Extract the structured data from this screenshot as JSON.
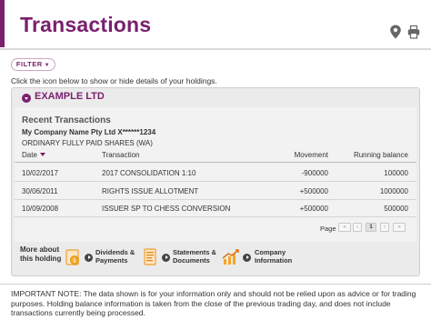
{
  "header": {
    "title": "Transactions",
    "icons": [
      "location-pin-icon",
      "printer-icon"
    ],
    "accent_color": "#7a1f6e"
  },
  "filter": {
    "label": "FILTER"
  },
  "hint": "Click the icon below to show or hide details of your holdings.",
  "holding": {
    "name": "EXAMPLE LTD",
    "section_title": "Recent Transactions",
    "company": "My Company Name Pty Ltd X******1234",
    "security": "ORDINARY FULLY PAID SHARES (WA)",
    "columns": [
      "Date",
      "Transaction",
      "Movement",
      "Running balance"
    ],
    "rows": [
      {
        "date": "10/02/2017",
        "transaction": "2017 CONSOLIDATION 1:10",
        "movement": "-900000",
        "balance": "100000"
      },
      {
        "date": "30/06/2011",
        "transaction": "RIGHTS ISSUE ALLOTMENT",
        "movement": "+500000",
        "balance": "1000000"
      },
      {
        "date": "10/09/2008",
        "transaction": "ISSUER SP TO CHESS CONVERSION",
        "movement": "+500000",
        "balance": "500000"
      }
    ],
    "pager": {
      "label": "Page",
      "first": "«",
      "prev": "‹",
      "current": "1",
      "next": "›",
      "last": "»"
    },
    "more_about": "More about this holding",
    "links": [
      {
        "label_line1": "Dividends &",
        "label_line2": "Payments",
        "icon": "dividends-icon"
      },
      {
        "label_line1": "Statements &",
        "label_line2": "Documents",
        "icon": "statements-icon"
      },
      {
        "label_line1": "Company",
        "label_line2": "Information",
        "icon": "company-chart-icon"
      }
    ]
  },
  "important_note": "IMPORTANT NOTE: The data shown is for your information only and should not be relied upon as advice or for trading purposes. Holding balance information is taken from the close of the previous trading day, and does not include transactions currently being processed."
}
